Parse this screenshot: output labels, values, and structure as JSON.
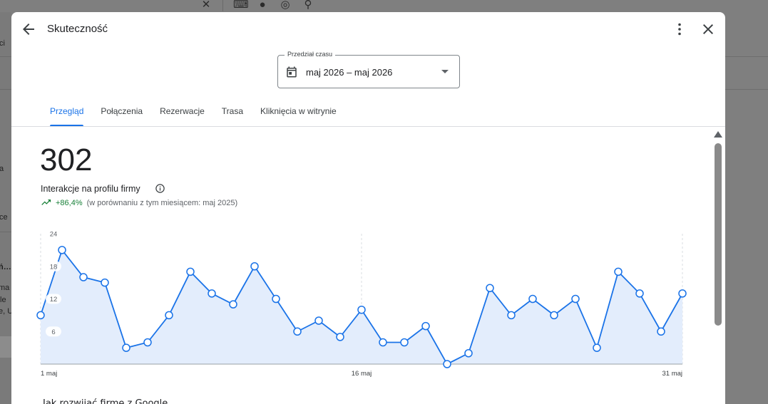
{
  "background": {
    "left_snippets": [
      "ci",
      "a",
      "ce",
      "ń…",
      "ma",
      "ziele",
      "e, U"
    ],
    "top_icons": [
      "close-icon",
      "keyboard-icon",
      "mic-icon",
      "lens-icon",
      "search-icon"
    ]
  },
  "dialog": {
    "title": "Skuteczność",
    "date_range": {
      "label": "Przedział czasu",
      "value": "maj 2026 – maj 2026"
    },
    "tabs": [
      {
        "label": "Przegląd",
        "active": true
      },
      {
        "label": "Połączenia",
        "active": false
      },
      {
        "label": "Rezerwacje",
        "active": false
      },
      {
        "label": "Trasa",
        "active": false
      },
      {
        "label": "Kliknięcia w witrynie",
        "active": false
      }
    ],
    "metric": {
      "value": "302",
      "label": "Interakcje na profilu firmy",
      "change": "+86,4%",
      "comparison": "(w porównaniu z tym miesiącem: maj 2025)"
    },
    "footer_heading": "Jak rozwijać firmę z Google"
  },
  "colors": {
    "accent": "#1a73e8",
    "positive": "#188038",
    "area_fill": "#e3edfc"
  },
  "chart_data": {
    "type": "area",
    "x": [
      1,
      2,
      3,
      4,
      5,
      6,
      7,
      8,
      9,
      10,
      11,
      12,
      13,
      14,
      15,
      16,
      17,
      18,
      19,
      20,
      21,
      22,
      23,
      24,
      25,
      26,
      27,
      28,
      29,
      30,
      31
    ],
    "values": [
      9,
      21,
      16,
      15,
      3,
      4,
      9,
      17,
      13,
      11,
      18,
      12,
      6,
      8,
      5,
      10,
      4,
      4,
      7,
      0,
      2,
      14,
      9,
      12,
      9,
      12,
      3,
      17,
      13,
      6,
      13
    ],
    "x_tick_labels": [
      {
        "x": 1,
        "label": "1 maj"
      },
      {
        "x": 16,
        "label": "16 maj"
      },
      {
        "x": 31,
        "label": "31 maj"
      }
    ],
    "y_ticks": [
      6,
      12,
      18,
      24
    ],
    "ylim": [
      0,
      24
    ],
    "grid": "vertical dashed at tick dates"
  }
}
